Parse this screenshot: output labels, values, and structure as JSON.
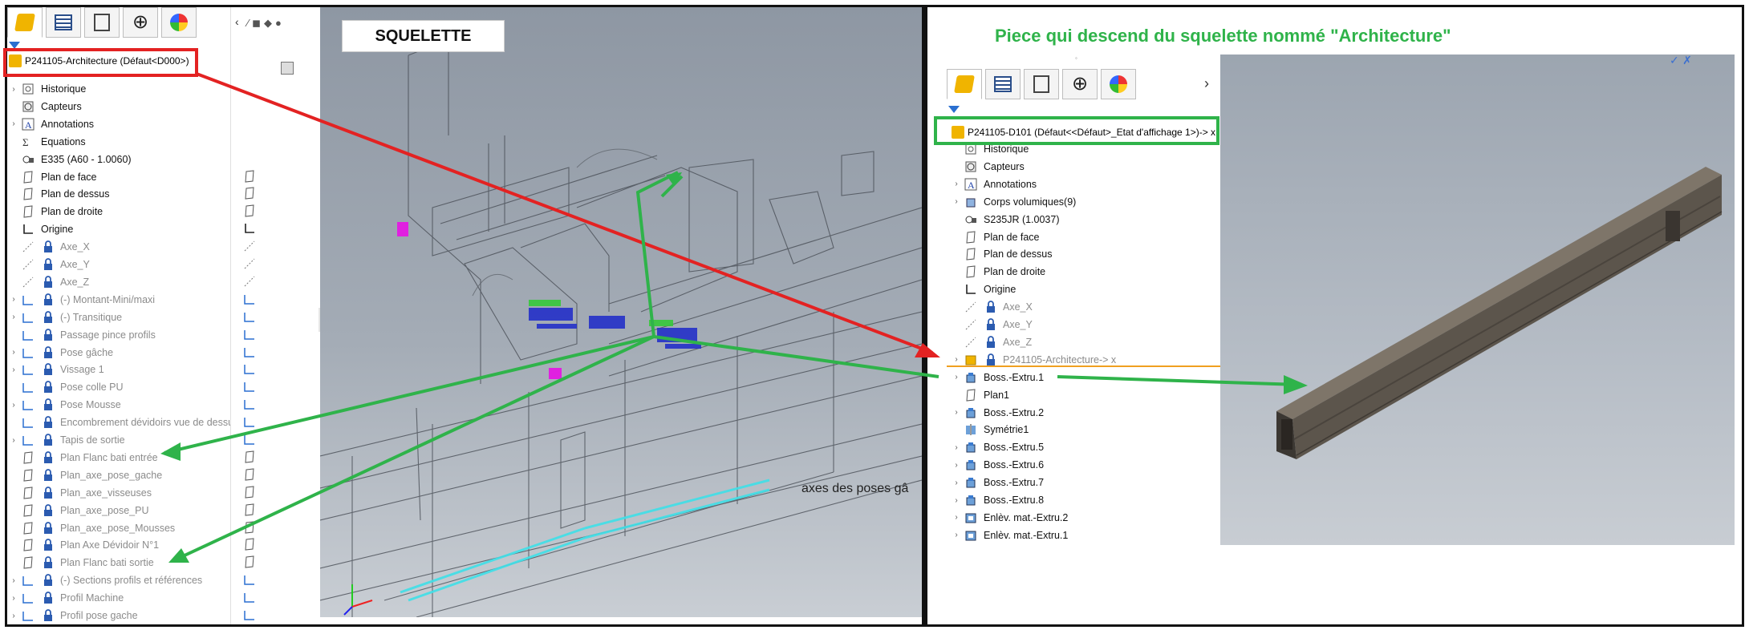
{
  "left": {
    "overlay_title": "SQUELETTE",
    "top_item": "P241105-Architecture  (Défaut<D000>)",
    "icon_tabs": [
      "feature-manager-icon",
      "property-manager-icon",
      "configuration-manager-icon",
      "dimxpert-icon",
      "display-manager-icon"
    ],
    "tree": [
      {
        "label": "Historique",
        "icon": "history",
        "exp": true,
        "gray": false
      },
      {
        "label": "Capteurs",
        "icon": "sensor",
        "exp": false,
        "gray": false
      },
      {
        "label": "Annotations",
        "icon": "annotation",
        "exp": true,
        "gray": false
      },
      {
        "label": "Equations",
        "icon": "equation",
        "exp": false,
        "gray": false
      },
      {
        "label": "E335 (A60 - 1.0060)",
        "icon": "material",
        "exp": false,
        "gray": false
      },
      {
        "label": "Plan de face",
        "icon": "plane",
        "exp": false,
        "gray": false
      },
      {
        "label": "Plan de dessus",
        "icon": "plane",
        "exp": false,
        "gray": false
      },
      {
        "label": "Plan de droite",
        "icon": "plane",
        "exp": false,
        "gray": false
      },
      {
        "label": "Origine",
        "icon": "origin",
        "exp": false,
        "gray": false
      },
      {
        "label": "Axe_X",
        "icon": "axis",
        "lock": true,
        "exp": false,
        "gray": true
      },
      {
        "label": "Axe_Y",
        "icon": "axis",
        "lock": true,
        "exp": false,
        "gray": true
      },
      {
        "label": "Axe_Z",
        "icon": "axis",
        "lock": true,
        "exp": false,
        "gray": true
      },
      {
        "label": "(-) Montant-Mini/maxi",
        "icon": "sketch",
        "lock": true,
        "exp": true,
        "gray": true
      },
      {
        "label": "(-) Transitique",
        "icon": "sketch",
        "lock": true,
        "exp": true,
        "gray": true
      },
      {
        "label": "Passage pince profils",
        "icon": "sketch",
        "lock": true,
        "exp": false,
        "gray": true
      },
      {
        "label": "Pose gâche",
        "icon": "sketch",
        "lock": true,
        "exp": true,
        "gray": true
      },
      {
        "label": "Vissage 1",
        "icon": "sketch",
        "lock": true,
        "exp": true,
        "gray": true
      },
      {
        "label": "Pose colle PU",
        "icon": "sketch",
        "lock": true,
        "exp": false,
        "gray": true
      },
      {
        "label": "Pose Mousse",
        "icon": "sketch",
        "lock": true,
        "exp": true,
        "gray": true
      },
      {
        "label": "Encombrement dévidoirs vue de dessu",
        "icon": "sketch",
        "lock": true,
        "exp": false,
        "gray": true
      },
      {
        "label": "Tapis de sortie",
        "icon": "sketch",
        "lock": true,
        "exp": true,
        "gray": true
      },
      {
        "label": "Plan Flanc bati entrée",
        "icon": "plane",
        "lock": true,
        "exp": false,
        "gray": true
      },
      {
        "label": "Plan_axe_pose_gache",
        "icon": "plane",
        "lock": true,
        "exp": false,
        "gray": true
      },
      {
        "label": "Plan_axe_visseuses",
        "icon": "plane",
        "lock": true,
        "exp": false,
        "gray": true
      },
      {
        "label": "Plan_axe_pose_PU",
        "icon": "plane",
        "lock": true,
        "exp": false,
        "gray": true
      },
      {
        "label": "Plan_axe_pose_Mousses",
        "icon": "plane",
        "lock": true,
        "exp": false,
        "gray": true
      },
      {
        "label": "Plan Axe Dévidoir N°1",
        "icon": "plane",
        "lock": true,
        "exp": false,
        "gray": true
      },
      {
        "label": "Plan Flanc bati sortie",
        "icon": "plane",
        "lock": true,
        "exp": false,
        "gray": true
      },
      {
        "label": "(-) Sections  profils et références",
        "icon": "sketch",
        "lock": true,
        "exp": true,
        "gray": true
      },
      {
        "label": "Profil Machine",
        "icon": "sketch",
        "lock": true,
        "exp": true,
        "gray": true
      },
      {
        "label": "Profil pose gache",
        "icon": "sketch",
        "lock": true,
        "exp": true,
        "gray": true
      }
    ],
    "viewport_annotation": "axes des poses gâ"
  },
  "right": {
    "heading": "Piece qui descend du squelette nommé \"Architecture\"",
    "top_item": "P241105-D101  (Défaut<<Défaut>_Etat d'affichage 1>)-> x",
    "tree": [
      {
        "label": "Historique",
        "icon": "history",
        "exp": false,
        "gray": false
      },
      {
        "label": "Capteurs",
        "icon": "sensor",
        "exp": false,
        "gray": false
      },
      {
        "label": "Annotations",
        "icon": "annotation",
        "exp": true,
        "gray": false
      },
      {
        "label": "Corps volumiques(9)",
        "icon": "solid",
        "exp": true,
        "gray": false
      },
      {
        "label": "S235JR (1.0037)",
        "icon": "material",
        "exp": false,
        "gray": false
      },
      {
        "label": "Plan de face",
        "icon": "plane",
        "exp": false,
        "gray": false
      },
      {
        "label": "Plan de dessus",
        "icon": "plane",
        "exp": false,
        "gray": false
      },
      {
        "label": "Plan de droite",
        "icon": "plane",
        "exp": false,
        "gray": false
      },
      {
        "label": "Origine",
        "icon": "origin",
        "exp": false,
        "gray": false
      },
      {
        "label": "Axe_X",
        "icon": "axis",
        "lock": true,
        "exp": false,
        "gray": true
      },
      {
        "label": "Axe_Y",
        "icon": "axis",
        "lock": true,
        "exp": false,
        "gray": true
      },
      {
        "label": "Axe_Z",
        "icon": "axis",
        "lock": true,
        "exp": false,
        "gray": true
      },
      {
        "label": "P241105-Architecture-> x",
        "icon": "part",
        "lock": true,
        "exp": true,
        "gray": true
      },
      {
        "label": "Boss.-Extru.1",
        "icon": "extrude",
        "exp": true,
        "gray": false
      },
      {
        "label": "Plan1",
        "icon": "plane",
        "exp": false,
        "gray": false
      },
      {
        "label": "Boss.-Extru.2",
        "icon": "extrude",
        "exp": true,
        "gray": false
      },
      {
        "label": "Symétrie1",
        "icon": "mirror",
        "exp": false,
        "gray": false
      },
      {
        "label": "Boss.-Extru.5",
        "icon": "extrude",
        "exp": true,
        "gray": false
      },
      {
        "label": "Boss.-Extru.6",
        "icon": "extrude",
        "exp": true,
        "gray": false
      },
      {
        "label": "Boss.-Extru.7",
        "icon": "extrude",
        "exp": true,
        "gray": false
      },
      {
        "label": "Boss.-Extru.8",
        "icon": "extrude",
        "exp": true,
        "gray": false
      },
      {
        "label": "Enlèv. mat.-Extru.2",
        "icon": "cut",
        "exp": true,
        "gray": false
      },
      {
        "label": "Enlèv. mat.-Extru.1",
        "icon": "cut",
        "exp": true,
        "gray": false
      }
    ]
  },
  "colors": {
    "red": "#e32222",
    "green": "#2fb34a",
    "frame": "#111111",
    "viewport": "#9aa3ae"
  }
}
